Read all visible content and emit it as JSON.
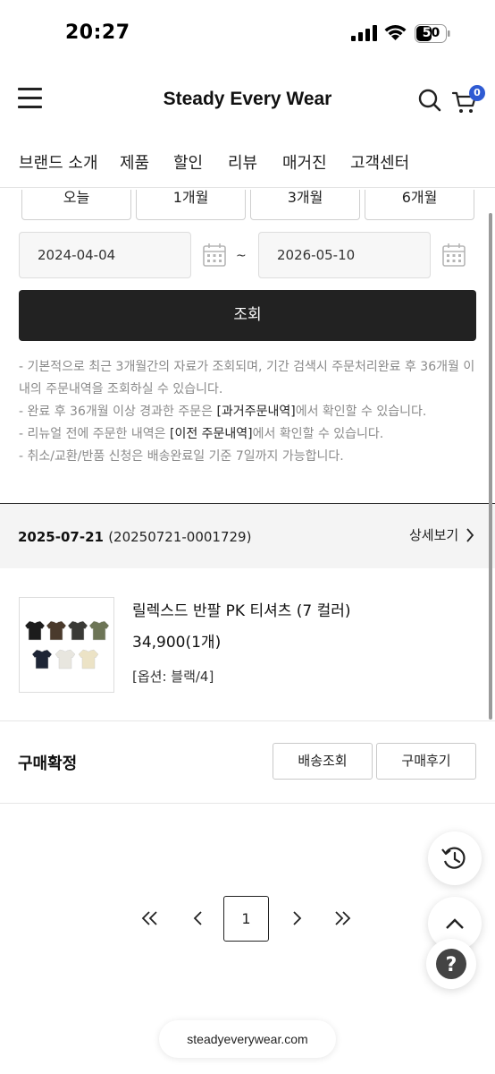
{
  "status_bar": {
    "time": "20:27",
    "battery": "50"
  },
  "header": {
    "brand": "Steady Every Wear",
    "cart_count": "0"
  },
  "nav": {
    "items": [
      "브랜드 소개",
      "제품",
      "할인",
      "리뷰",
      "매거진",
      "고객센터"
    ]
  },
  "period": {
    "buttons": [
      "오늘",
      "1개월",
      "3개월",
      "6개월"
    ]
  },
  "date_range": {
    "start": "2024-04-04",
    "separator": "~",
    "end": "2026-05-10"
  },
  "search_button": "조회",
  "notes": {
    "line1": "- 기본적으로 최근 3개월간의 자료가 조회되며, 기간 검색시 주문처리완료 후 36개월 이내의 주문내역을 조회하실 수 있습니다.",
    "line2_pre": "- 완료 후 36개월 이상 경과한 주문은 ",
    "line2_em": "[과거주문내역]",
    "line2_post": "에서 확인할 수 있습니다.",
    "line3_pre": "- 리뉴얼 전에 주문한 내역은 ",
    "line3_em": "[이전 주문내역]",
    "line3_post": "에서 확인할 수 있습니다.",
    "line4": "- 취소/교환/반품 신청은 배송완료일 기준 7일까지 가능합니다."
  },
  "order": {
    "date": "2025-07-21",
    "number": "(20250721-0001729)",
    "detail_label": "상세보기",
    "product_name": "릴렉스드 반팔 PK 티셔츠 (7 컬러)",
    "price": "34,900(1개)",
    "option": "[옵션: 블랙/4]",
    "status": "구매확정",
    "ship_button": "배송조회",
    "review_button": "구매후기",
    "swatch_colors": [
      "#1c1c1c",
      "#4a3a2c",
      "#3a3a36",
      "#6d7556",
      "#1e2535",
      "#e8e6df",
      "#ece3c6"
    ]
  },
  "pagination": {
    "current": "1"
  },
  "browser": {
    "url": "steadyeverywear.com"
  }
}
